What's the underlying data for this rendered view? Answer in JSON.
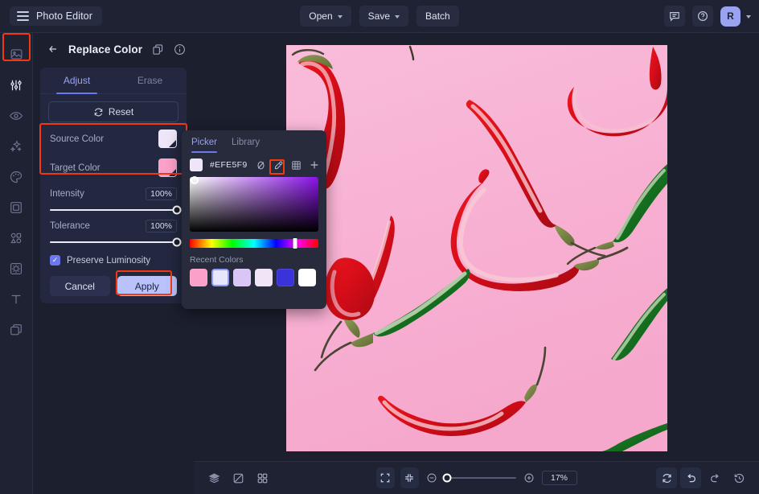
{
  "app": {
    "brand": "Photo Editor",
    "menu_icon": "hamburger-icon"
  },
  "topbar": {
    "open_label": "Open",
    "save_label": "Save",
    "batch_label": "Batch",
    "comment_icon": "comment-icon",
    "help_icon": "help-circle-icon",
    "avatar_initial": "R",
    "account_caret": "chevron-down-icon"
  },
  "rail": {
    "items": [
      {
        "name": "image-icon",
        "active": false
      },
      {
        "name": "adjustments-icon",
        "active": true
      },
      {
        "name": "eye-icon",
        "active": false
      },
      {
        "name": "sparkles-icon",
        "active": false
      },
      {
        "name": "palette-icon",
        "active": false
      },
      {
        "name": "frame-icon",
        "active": false
      },
      {
        "name": "shapes-icon",
        "active": false
      },
      {
        "name": "effects-icon",
        "active": false
      },
      {
        "name": "text-icon",
        "active": false
      },
      {
        "name": "layers-icon",
        "active": false
      }
    ]
  },
  "panel": {
    "back_icon": "arrow-left-icon",
    "title": "Replace Color",
    "copy_icon": "duplicate-icon",
    "info_icon": "info-circle-icon",
    "tabs": [
      {
        "label": "Adjust",
        "active": true
      },
      {
        "label": "Erase",
        "active": false
      }
    ],
    "reset_label": "Reset",
    "reset_icon": "refresh-icon",
    "source_color": {
      "label": "Source Color",
      "value": "#EFE5F9"
    },
    "target_color": {
      "label": "Target Color",
      "value": "#FBA0C8"
    },
    "intensity": {
      "label": "Intensity",
      "value": "100%",
      "percent": 100
    },
    "tolerance": {
      "label": "Tolerance",
      "value": "100%",
      "percent": 100
    },
    "preserve_luminosity": {
      "label": "Preserve Luminosity",
      "checked": true,
      "check_glyph": "✓"
    },
    "cancel_label": "Cancel",
    "apply_label": "Apply",
    "highlight_color": "#F23A12"
  },
  "picker": {
    "tabs": [
      {
        "label": "Picker",
        "active": true
      },
      {
        "label": "Library",
        "active": false
      }
    ],
    "hex_value": "#EFE5F9",
    "swatch_color": "#EFE5F9",
    "tools": [
      {
        "name": "no-color-icon"
      },
      {
        "name": "eyedropper-icon",
        "highlighted": true
      },
      {
        "name": "grid-icon"
      },
      {
        "name": "add-icon"
      }
    ],
    "sv_knob": {
      "x_percent": 4,
      "y_percent": 6
    },
    "hue_percent": 82,
    "recent_label": "Recent Colors",
    "recent_colors": [
      {
        "hex": "#FBA0C8",
        "selected": false
      },
      {
        "hex": "#E7E6FA",
        "selected": true
      },
      {
        "hex": "#D9C6F7",
        "selected": false
      },
      {
        "hex": "#F0E4F7",
        "selected": false
      },
      {
        "hex": "#3A33DB",
        "selected": false
      },
      {
        "hex": "#FFFFFF",
        "selected": false
      }
    ]
  },
  "bottombar": {
    "left_tools": [
      {
        "name": "layers-stack-icon"
      },
      {
        "name": "compare-icon"
      },
      {
        "name": "grid-view-icon"
      }
    ],
    "center_tools": [
      {
        "name": "fit-screen-icon"
      },
      {
        "name": "actual-size-icon"
      },
      {
        "name": "zoom-out-icon"
      },
      {
        "name": "zoom-in-icon"
      }
    ],
    "zoom_value": "17%",
    "zoom_percent": 17,
    "right_tools": [
      {
        "name": "rotate-icon"
      },
      {
        "name": "undo-icon"
      },
      {
        "name": "redo-icon"
      },
      {
        "name": "history-icon"
      }
    ]
  },
  "canvas": {
    "background_color": "#F7B3D4",
    "photo_description": "red and green chili peppers on pink background"
  }
}
